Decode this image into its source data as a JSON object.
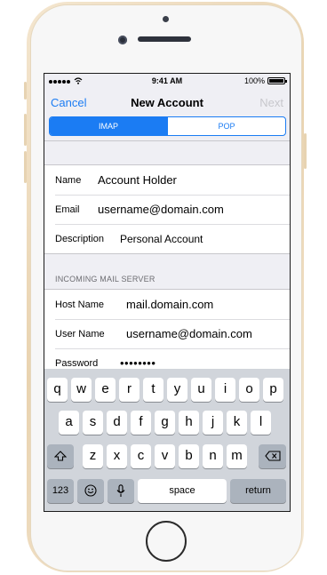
{
  "status_bar": {
    "time": "9:41 AM",
    "battery": "100%"
  },
  "navbar": {
    "cancel": "Cancel",
    "title": "New Account",
    "next": "Next"
  },
  "segments": [
    "IMAP",
    "POP"
  ],
  "account": {
    "name_label": "Name",
    "name_value": "Account Holder",
    "email_label": "Email",
    "email_value": "username@domain.com",
    "description_label": "Description",
    "description_value": "Personal Account"
  },
  "incoming": {
    "header": "INCOMING MAIL SERVER",
    "host_label": "Host Name",
    "host_value": "mail.domain.com",
    "user_label": "User Name",
    "user_value": "username@domain.com",
    "password_label": "Password",
    "password_value": "••••••••"
  },
  "keyboard": {
    "row1": [
      "q",
      "w",
      "e",
      "r",
      "t",
      "y",
      "u",
      "i",
      "o",
      "p"
    ],
    "row2": [
      "a",
      "s",
      "d",
      "f",
      "g",
      "h",
      "j",
      "k",
      "l"
    ],
    "row3": [
      "z",
      "x",
      "c",
      "v",
      "b",
      "n",
      "m"
    ],
    "numbers": "123",
    "space": "space",
    "return": "return"
  },
  "colors": {
    "accent": "#1b7cf3",
    "frame": "#e9d3b0"
  }
}
